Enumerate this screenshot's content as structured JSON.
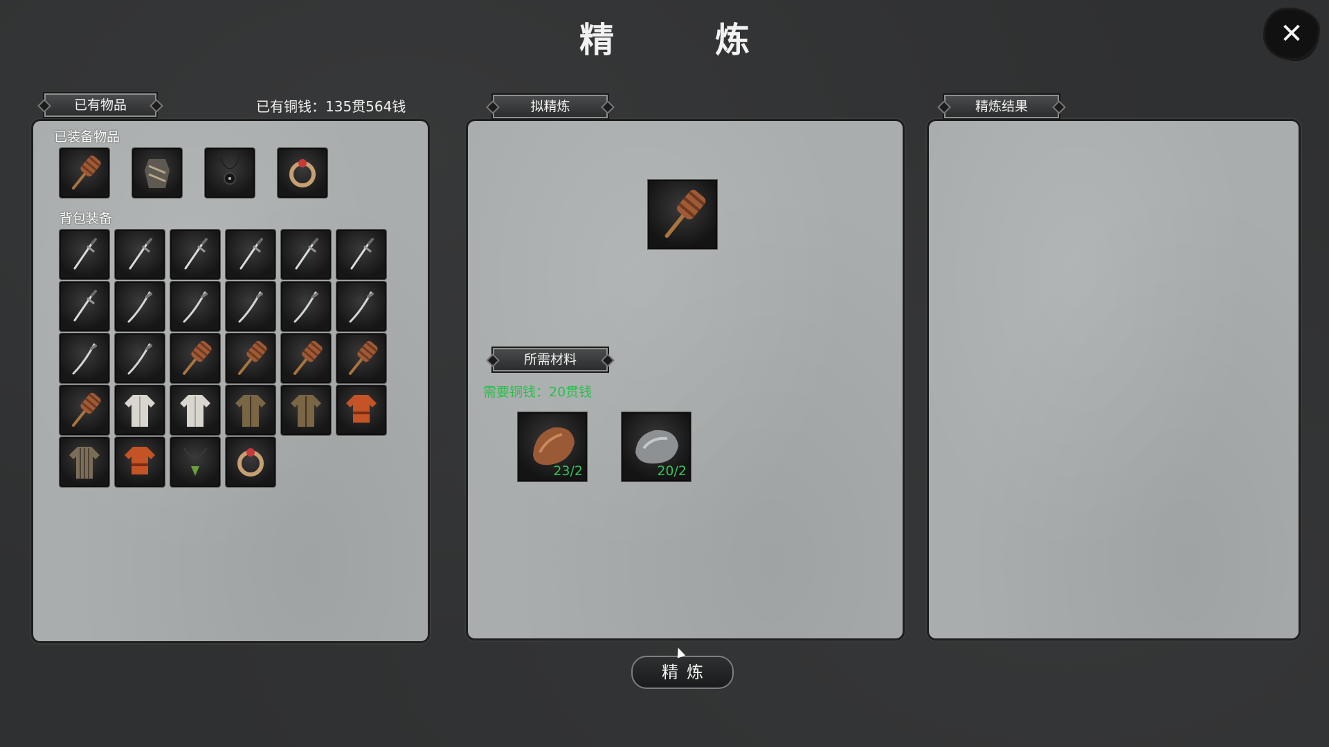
{
  "screen": {
    "title": "精　炼",
    "close_label": "✕"
  },
  "inventory": {
    "tab_label": "已有物品",
    "money_text": "已有铜钱：135贯564钱",
    "equipped_label": "已装备物品",
    "equipped_items": [
      "hammer-icon",
      "armor-icon",
      "amulet-icon",
      "ring-icon"
    ],
    "bag_label": "背包装备",
    "bag_items": [
      "sword-icon",
      "sword-icon",
      "sword-icon",
      "sword-icon",
      "sword-icon",
      "sword-icon",
      "sword-icon",
      "saber-icon",
      "saber-icon",
      "saber-icon",
      "saber-icon",
      "saber-icon",
      "saber-icon",
      "saber-icon",
      "hammer-icon",
      "hammer-icon",
      "hammer-icon",
      "hammer-icon",
      "hammer-icon",
      "robe-white-icon",
      "robe-white-icon",
      "robe-brown-icon",
      "robe-brown-icon",
      "robe-red-icon",
      "robe-striped-icon",
      "robe-red-icon",
      "necklace-green-icon",
      "ring-icon"
    ]
  },
  "refine": {
    "tab_label": "拟精炼",
    "target_item": "hammer-icon",
    "materials_tab_label": "所需材料",
    "cost_text": "需要铜钱：20贯钱",
    "materials": [
      {
        "icon": "copper-ore-icon",
        "qty": "23/2"
      },
      {
        "icon": "iron-ore-icon",
        "qty": "20/2"
      }
    ]
  },
  "result": {
    "tab_label": "精炼结果"
  },
  "action": {
    "refine_button_label": "精炼"
  },
  "colors": {
    "panel_bg": "#a9adad",
    "page_bg": "#2f3031",
    "quantity_green": "#36c45a",
    "cost_green": "#27c24a"
  }
}
